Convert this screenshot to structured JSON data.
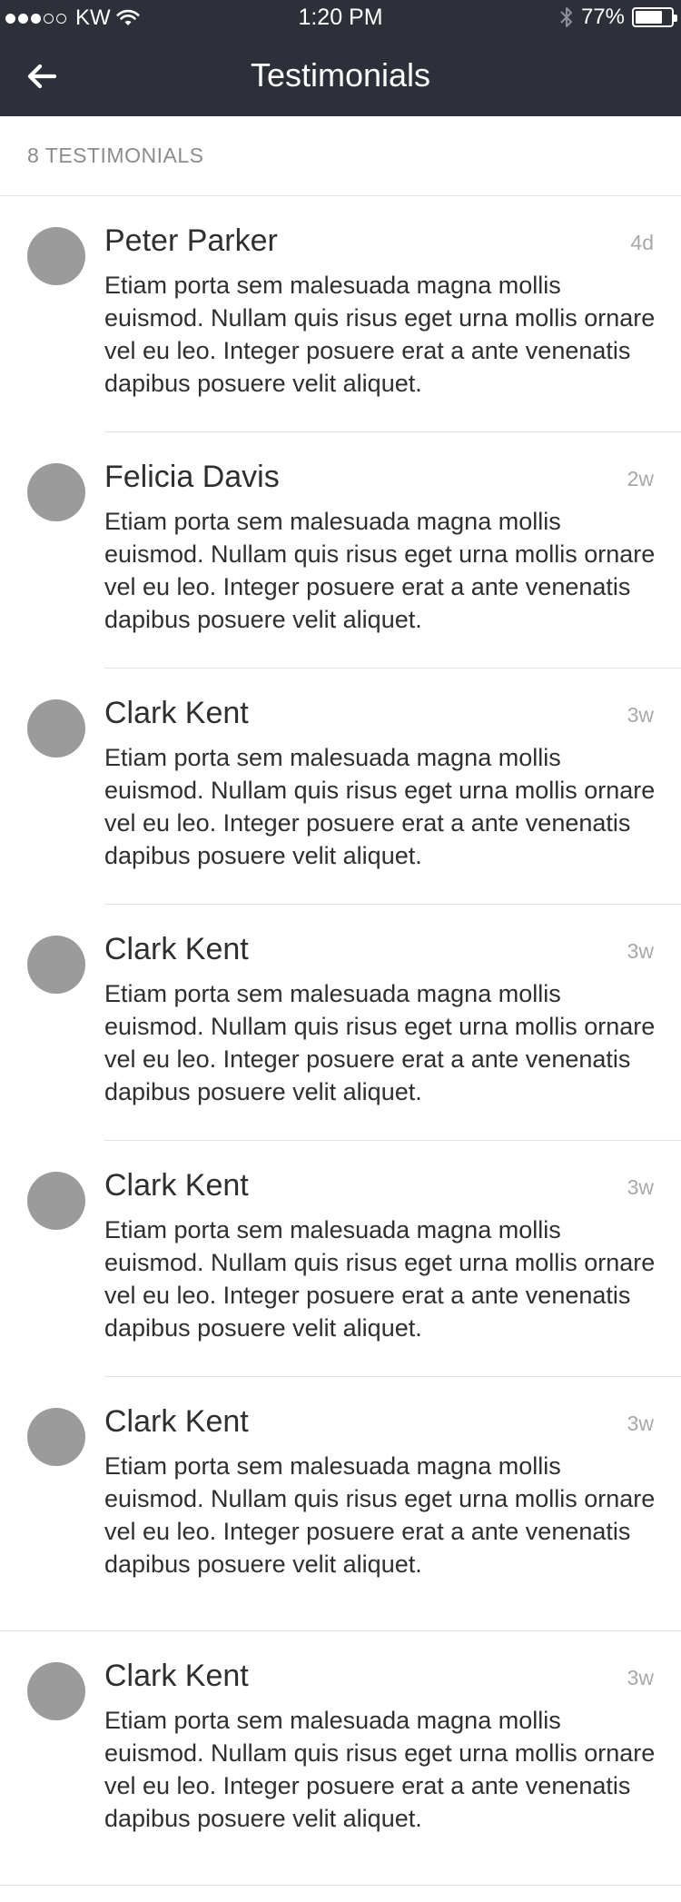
{
  "status_bar": {
    "carrier": "KW",
    "time": "1:20 PM",
    "battery": "77%",
    "battery_level": 0.77,
    "signal_bars_filled": 3,
    "signal_bars_total": 5
  },
  "nav": {
    "title": "Testimonials",
    "back_icon": "arrow-left-icon"
  },
  "list_header": {
    "count_label": "8 TESTIMONIALS"
  },
  "testimonials": [
    {
      "name": "Peter Parker",
      "time": "4d",
      "text": "Etiam porta sem malesuada magna mollis euismod. Nullam quis risus eget urna mollis ornare vel eu leo. Integer posuere erat a ante venenatis dapibus posuere velit aliquet."
    },
    {
      "name": "Felicia Davis",
      "time": "2w",
      "text": "Etiam porta sem malesuada magna mollis euismod. Nullam quis risus eget urna mollis ornare vel eu leo. Integer posuere erat a ante venenatis dapibus posuere velit aliquet."
    },
    {
      "name": "Clark Kent",
      "time": "3w",
      "text": "Etiam porta sem malesuada magna mollis euismod. Nullam quis risus eget urna mollis ornare vel eu leo. Integer posuere erat a ante venenatis dapibus posuere velit aliquet."
    },
    {
      "name": "Clark Kent",
      "time": "3w",
      "text": "Etiam porta sem malesuada magna mollis euismod. Nullam quis risus eget urna mollis ornare vel eu leo. Integer posuere erat a ante venenatis dapibus posuere velit aliquet."
    },
    {
      "name": "Clark Kent",
      "time": "3w",
      "text": "Etiam porta sem malesuada magna mollis euismod. Nullam quis risus eget urna mollis ornare vel eu leo. Integer posuere erat a ante venenatis dapibus posuere velit aliquet."
    },
    {
      "name": "Clark Kent",
      "time": "3w",
      "text": "Etiam porta sem malesuada magna mollis euismod. Nullam quis risus eget urna mollis ornare vel eu leo. Integer posuere erat a ante venenatis dapibus posuere velit aliquet."
    },
    {
      "name": "Clark Kent",
      "time": "3w",
      "text": "Etiam porta sem malesuada magna mollis euismod. Nullam quis risus eget urna mollis ornare vel eu leo. Integer posuere erat a ante venenatis dapibus posuere velit aliquet."
    }
  ],
  "colors": {
    "header_bg": "#2d3039",
    "avatar": "#9b9b9b",
    "divider": "#e3e3e3",
    "muted_text": "#8c8c8c"
  }
}
